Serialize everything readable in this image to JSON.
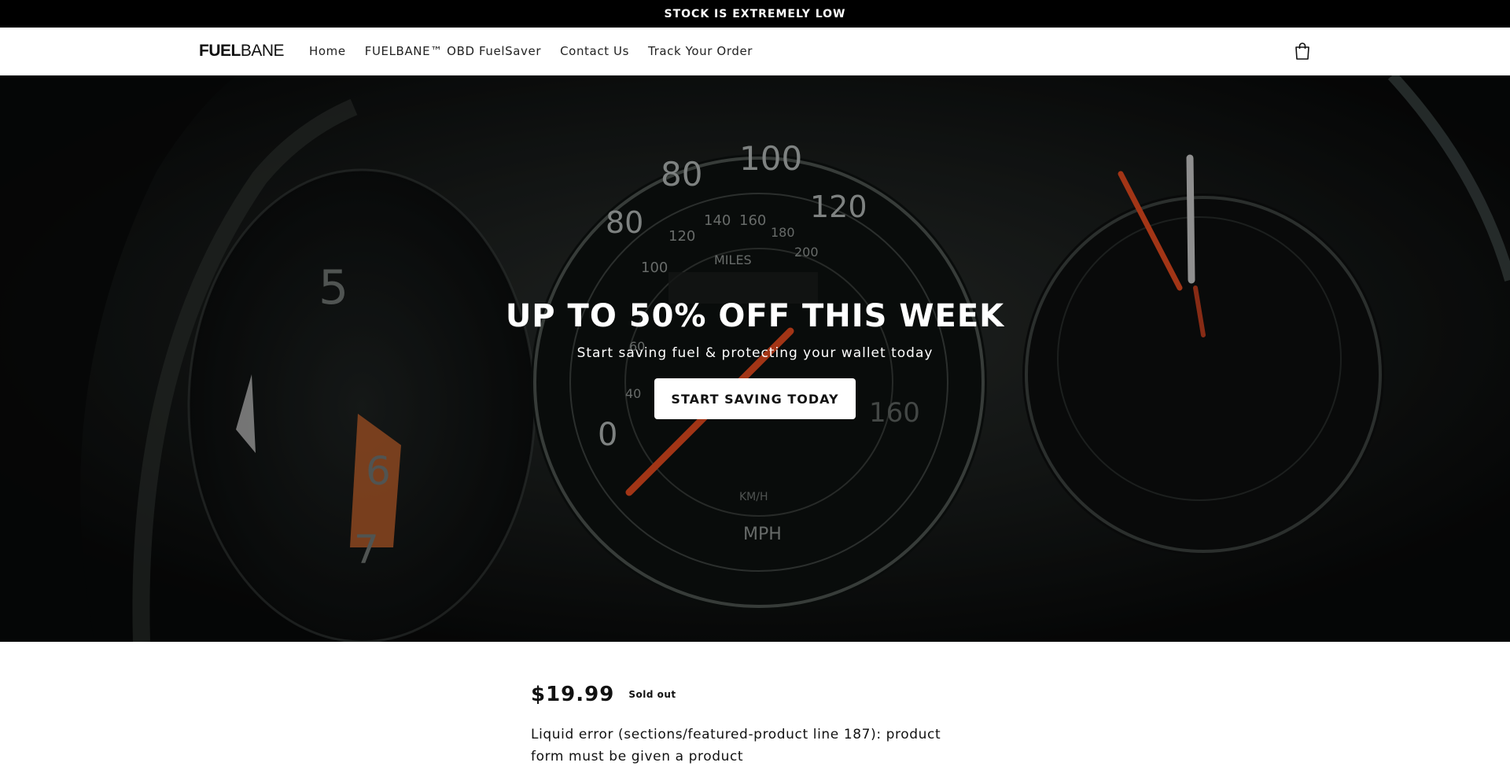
{
  "announcement": {
    "text": "STOCK IS EXTREMELY LOW"
  },
  "header": {
    "logo_strong": "FUEL",
    "logo_light": "BANE",
    "nav": [
      {
        "label": "Home"
      },
      {
        "label": "FUELBANE™ OBD FuelSaver"
      },
      {
        "label": "Contact Us"
      },
      {
        "label": "Track Your Order"
      }
    ],
    "cart_icon": "shopping-bag-icon"
  },
  "hero": {
    "title": "UP TO 50% OFF THIS WEEK",
    "subtitle": "Start saving fuel & protecting your wallet today",
    "cta": "START SAVING TODAY",
    "gauge_labels": [
      "80",
      "100",
      "120",
      "120",
      "140",
      "160",
      "180",
      "200",
      "MILES",
      "100",
      "80",
      "60",
      "40",
      "0",
      "KM/H",
      "MPH",
      "5",
      "6",
      "7",
      "160"
    ]
  },
  "product": {
    "price": "$19.99",
    "badge": "Sold out",
    "error": "Liquid error (sections/featured-product line 187): product form must be given a product"
  },
  "colors": {
    "announcement_bg": "#000000",
    "hero_bg": "#0f1211",
    "needle": "#d9471e"
  }
}
